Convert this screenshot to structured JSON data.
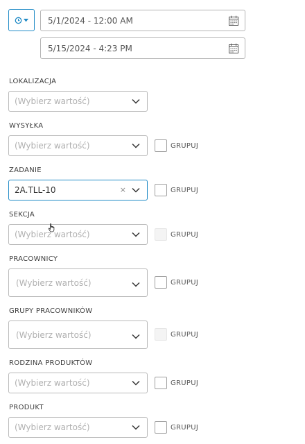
{
  "toolbar": {
    "clock_icon": "clock-icon",
    "start_date": "5/1/2024 - 12:00 AM",
    "end_date": "5/15/2024 - 4:23 PM",
    "calendar_icon": "calendar-icon"
  },
  "filters": {
    "lokalizacja": {
      "label": "LOKALIZACJA",
      "placeholder": "(Wybierz wartość)"
    },
    "wysylka": {
      "label": "WYSYŁKA",
      "placeholder": "(Wybierz wartość)",
      "group_label": "GRUPUJ",
      "group_checked": false,
      "group_enabled": true
    },
    "zadanie": {
      "label": "ZADANIE",
      "value": "2A.TLL-10",
      "clear": "×",
      "group_label": "GRUPUJ",
      "group_checked": false,
      "group_enabled": true
    },
    "sekcja": {
      "label": "SEKCJA",
      "placeholder": "(Wybierz wartość)",
      "group_label": "GRUPUJ",
      "group_checked": false,
      "group_enabled": false
    },
    "pracownicy": {
      "label": "PRACOWNICY",
      "placeholder": "(Wybierz wartość)",
      "group_label": "GRUPUJ",
      "group_checked": false,
      "group_enabled": true
    },
    "grupy_pracownikow": {
      "label": "GRUPY PRACOWNIKÓW",
      "placeholder": "(Wybierz wartość)",
      "group_label": "GRUPUJ",
      "group_checked": false,
      "group_enabled": false
    },
    "rodzina_produktow": {
      "label": "RODZINA PRODUKTÓW",
      "placeholder": "(Wybierz wartość)",
      "group_label": "GRUPUJ",
      "group_checked": false,
      "group_enabled": true
    },
    "produkt": {
      "label": "PRODUKT",
      "placeholder": "(Wybierz wartość)",
      "group_label": "GRUPUJ",
      "group_checked": false,
      "group_enabled": true
    }
  },
  "colors": {
    "accent": "#1f8ac6",
    "border": "#b9b9b9",
    "placeholder": "#b0b0b0",
    "text": "#333333"
  }
}
